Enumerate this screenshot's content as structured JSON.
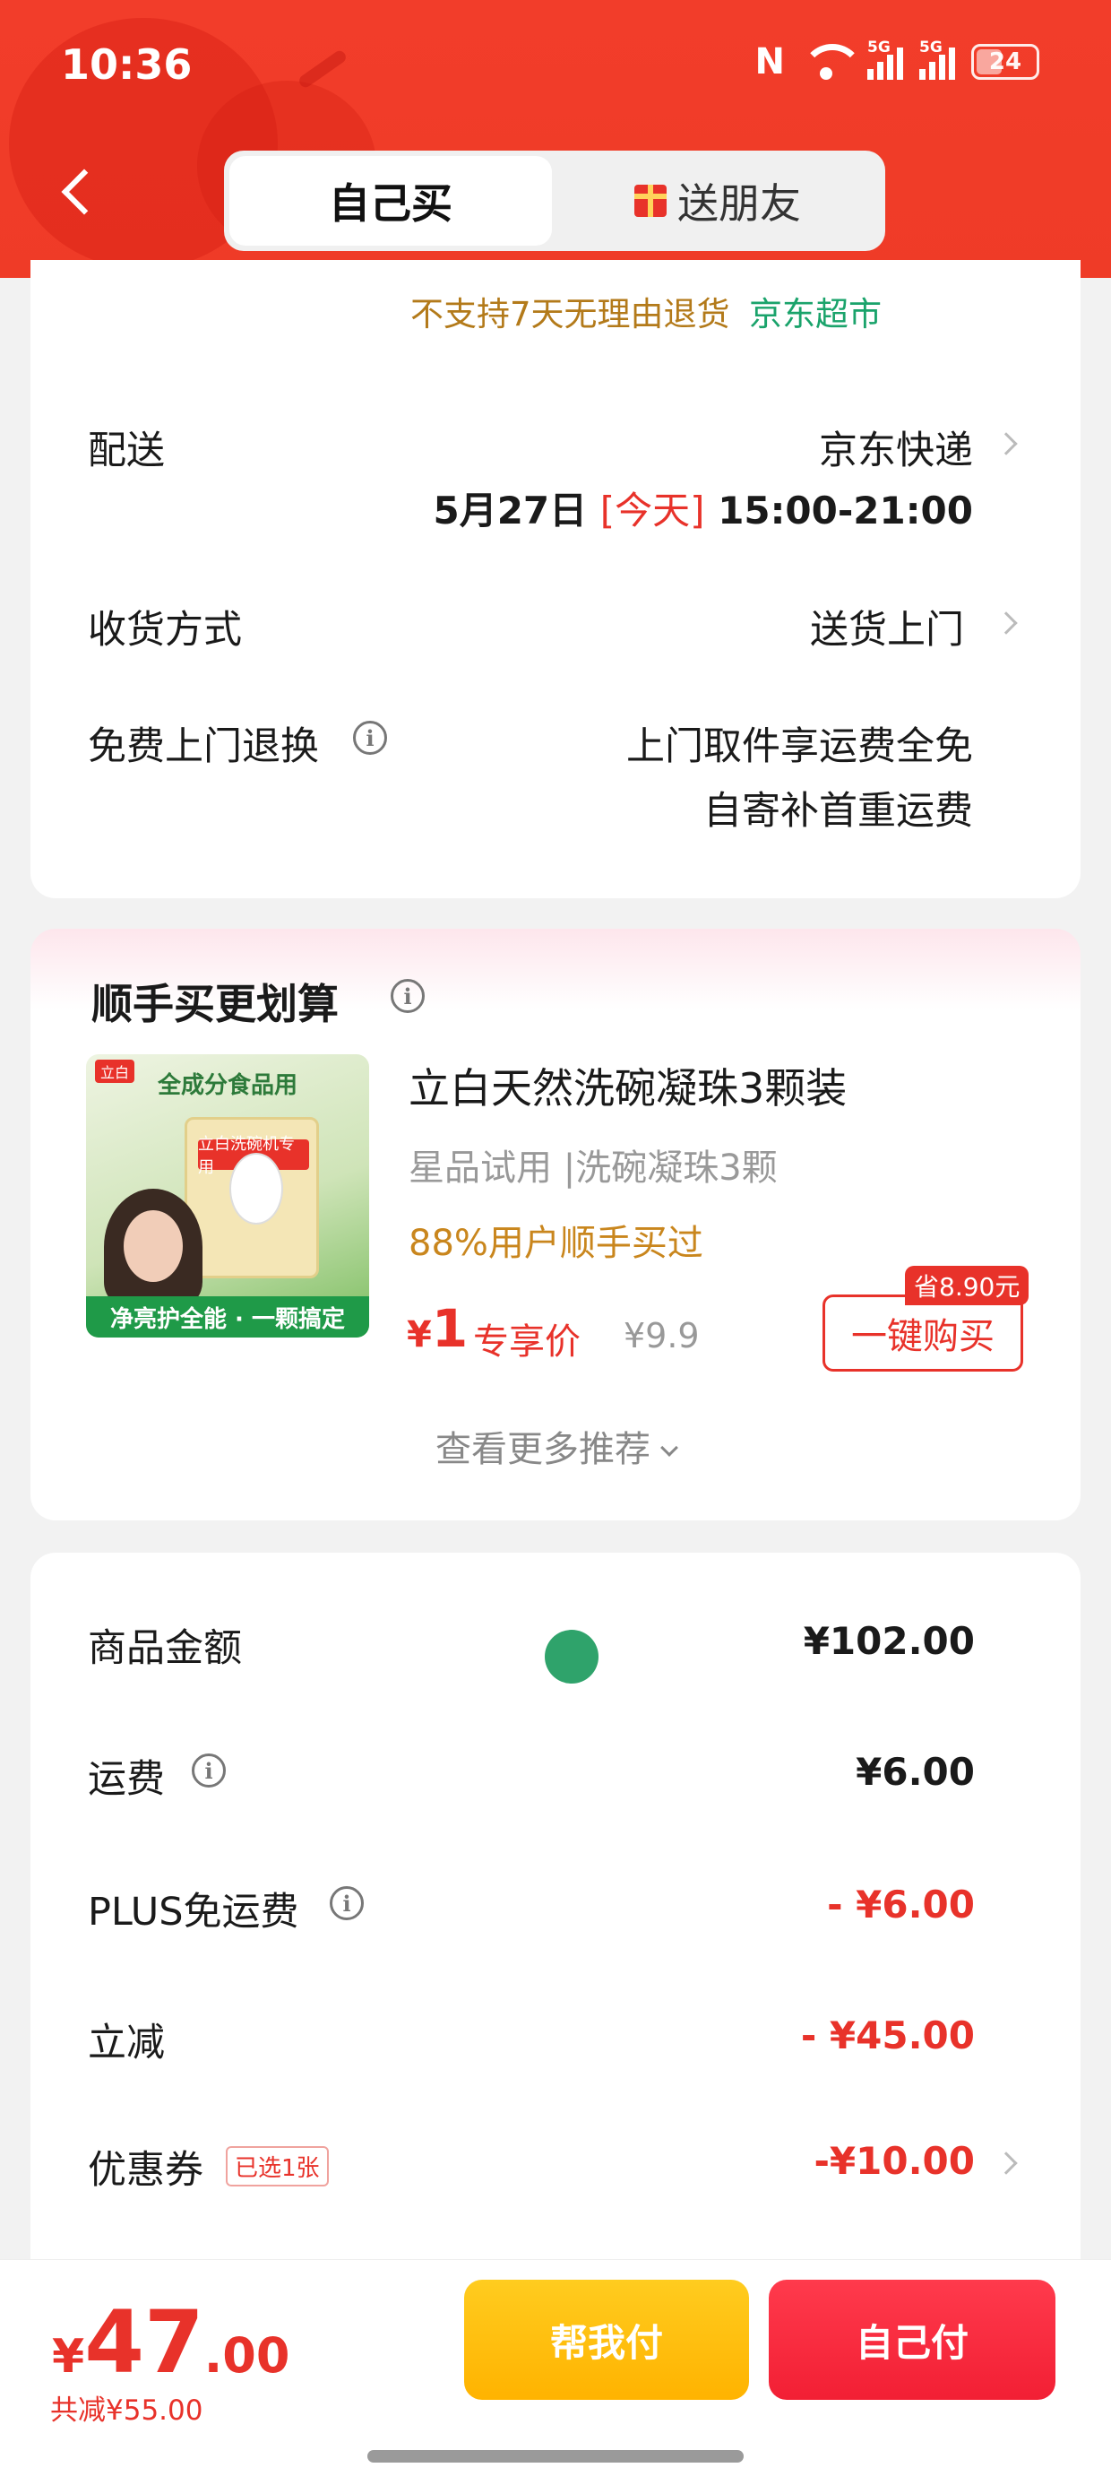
{
  "status_bar": {
    "time": "10:36",
    "battery": "24",
    "signal_label": "5G"
  },
  "header": {
    "tab_self": "自己买",
    "tab_gift": "送朋友"
  },
  "delivery_card": {
    "policy_note": "不支持7天无理由退货",
    "store_name": "京东超市",
    "delivery_label": "配送",
    "delivery_value": "京东快递",
    "delivery_date": "5月27日",
    "delivery_today": "[今天]",
    "delivery_window": "15:00-21:00",
    "receive_label": "收货方式",
    "receive_value": "送货上门",
    "return_label": "免费上门退换",
    "return_line1": "上门取件享运费全免",
    "return_line2": "自寄补首重运费"
  },
  "upsell_card": {
    "title": "顺手买更划算",
    "product_name": "立白天然洗碗凝珠3颗装",
    "product_spec": "星品试用 |洗碗凝珠3颗",
    "popularity": "88%用户顺手买过",
    "price_currency": "¥",
    "price_value": "1",
    "price_tag": "专享价",
    "original_price": "¥9.9",
    "save_badge": "省8.90元",
    "buy_button": "一键购买",
    "more_label": "查看更多推荐",
    "image_text": {
      "brand": "立白",
      "tagline": "全成分食品用",
      "box_label": "立白洗碗机专用",
      "ribbon": "净亮护全能 · 一颗搞定"
    }
  },
  "price_card": {
    "rows": [
      {
        "label": "商品金额",
        "value": "¥102.00"
      },
      {
        "label": "运费",
        "value": "¥6.00"
      },
      {
        "label": "PLUS免运费",
        "value": "- ¥6.00"
      },
      {
        "label": "立减",
        "value": "- ¥45.00"
      },
      {
        "label": "优惠券",
        "value": "-¥10.00",
        "badge": "已选1张"
      }
    ]
  },
  "bottom_bar": {
    "currency": "¥",
    "total_int": "47",
    "total_dec": ".00",
    "saved": "共减¥55.00",
    "help_pay": "帮我付",
    "self_pay": "自己付"
  },
  "colors": {
    "brand_red": "#e8322a",
    "header_red": "#f23d2a",
    "store_green": "#1aa36b",
    "policy_gold": "#b37a1a",
    "help_yellow": "#ffb300"
  }
}
